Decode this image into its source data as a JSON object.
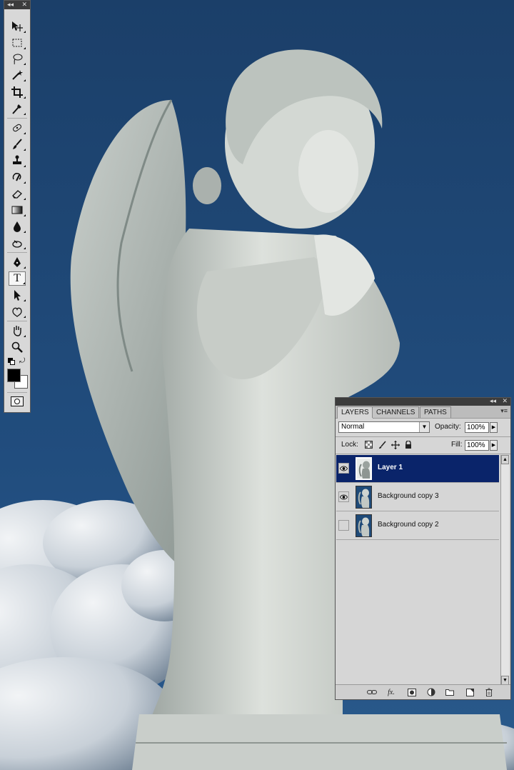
{
  "colors": {
    "selected_layer": "#0a246a",
    "panel_bg": "#d6d6d6",
    "sky": "#1f4a78"
  },
  "toolbox": {
    "collapse_label": "◂◂",
    "close_label": "✕",
    "tools": [
      {
        "name": "move-tool",
        "icon": "move-icon"
      },
      {
        "name": "marquee-tool",
        "icon": "marquee-icon"
      },
      {
        "name": "lasso-tool",
        "icon": "lasso-icon"
      },
      {
        "name": "magic-wand-tool",
        "icon": "magic-wand-icon"
      },
      {
        "name": "crop-tool",
        "icon": "crop-icon"
      },
      {
        "name": "eyedropper-tool",
        "icon": "eyedropper-icon"
      },
      {
        "name": "healing-brush-tool",
        "icon": "healing-icon"
      },
      {
        "name": "brush-tool",
        "icon": "brush-icon"
      },
      {
        "name": "clone-stamp-tool",
        "icon": "stamp-icon"
      },
      {
        "name": "history-brush-tool",
        "icon": "history-brush-icon"
      },
      {
        "name": "eraser-tool",
        "icon": "eraser-icon"
      },
      {
        "name": "gradient-tool",
        "icon": "gradient-icon"
      },
      {
        "name": "blur-tool",
        "icon": "blur-icon"
      },
      {
        "name": "dodge-tool",
        "icon": "dodge-icon"
      },
      {
        "name": "pen-tool",
        "icon": "pen-icon"
      },
      {
        "name": "type-tool",
        "icon": "type-icon",
        "label": "T",
        "selected": true
      },
      {
        "name": "path-selection-tool",
        "icon": "path-selection-icon"
      },
      {
        "name": "custom-shape-tool",
        "icon": "shape-icon"
      },
      {
        "name": "hand-tool",
        "icon": "hand-icon"
      },
      {
        "name": "zoom-tool",
        "icon": "zoom-icon"
      }
    ],
    "foreground_color": "#000000",
    "background_color": "#ffffff"
  },
  "layers_panel": {
    "collapse_label": "◂◂",
    "close_label": "✕",
    "tabs": [
      {
        "label": "LAYERS",
        "active": true
      },
      {
        "label": "CHANNELS",
        "active": false
      },
      {
        "label": "PATHS",
        "active": false
      }
    ],
    "menu_label": "▾≡",
    "blend_mode": "Normal",
    "opacity_label": "Opacity:",
    "opacity_value": "100%",
    "lock_label": "Lock:",
    "fill_label": "Fill:",
    "fill_value": "100%",
    "layers": [
      {
        "name": "Layer 1",
        "visible": true,
        "selected": true
      },
      {
        "name": "Background copy 3",
        "visible": true,
        "selected": false
      },
      {
        "name": "Background copy 2",
        "visible": false,
        "selected": false
      }
    ],
    "bottom_icons": [
      "link-icon",
      "fx-icon",
      "mask-icon",
      "adjustment-icon",
      "group-icon",
      "new-layer-icon",
      "trash-icon"
    ],
    "fx_label": "fx."
  }
}
